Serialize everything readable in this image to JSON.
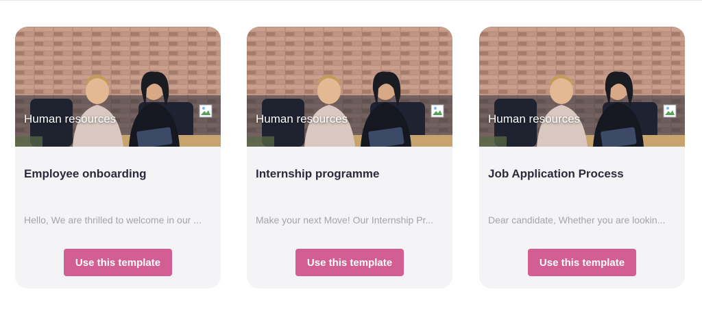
{
  "cards": [
    {
      "category": "Human resources",
      "image_icon": "broken-image-icon",
      "title": "Employee onboarding",
      "excerpt": "Hello, We are thrilled to welcome in our ...",
      "button_label": "Use this template"
    },
    {
      "category": "Human resources",
      "image_icon": "broken-image-icon",
      "title": "Internship programme",
      "excerpt": "Make your next Move! Our Internship Pr...",
      "button_label": "Use this template"
    },
    {
      "category": "Human resources",
      "image_icon": "broken-image-icon",
      "title": "Job Application Process",
      "excerpt": "Dear candidate, Whether you are lookin...",
      "button_label": "Use this template"
    }
  ],
  "colors": {
    "accent": "#d35e93",
    "card_bg": "#f4f4f7",
    "title_text": "#2a2a3a",
    "muted_text": "#a3a3ad"
  }
}
